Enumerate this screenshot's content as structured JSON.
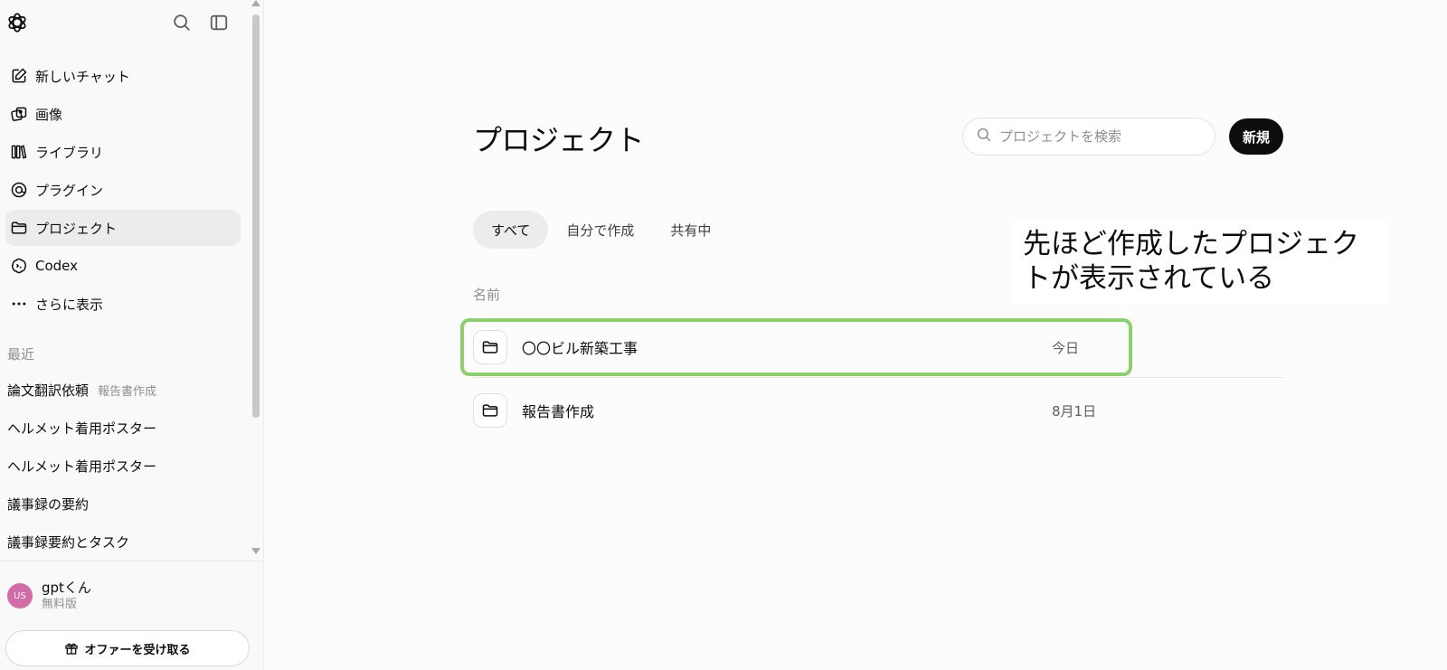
{
  "sidebar": {
    "nav": [
      {
        "label": "新しいチャット",
        "icon": "edit-icon"
      },
      {
        "label": "画像",
        "icon": "images-icon"
      },
      {
        "label": "ライブラリ",
        "icon": "library-icon"
      },
      {
        "label": "プラグイン",
        "icon": "plugin-icon"
      },
      {
        "label": "プロジェクト",
        "icon": "folder-icon",
        "active": true
      },
      {
        "label": "Codex",
        "icon": "codex-icon"
      },
      {
        "label": "さらに表示",
        "icon": "more-icon"
      }
    ],
    "recent_label": "最近",
    "recent": [
      {
        "label": "論文翻訳依頼",
        "sub": "報告書作成"
      },
      {
        "label": "ヘルメット着用ポスター"
      },
      {
        "label": "ヘルメット着用ポスター"
      },
      {
        "label": "議事録の要約"
      },
      {
        "label": "議事録要約とタスク"
      }
    ],
    "user": {
      "initials": "US",
      "name": "gptくん",
      "plan": "無料版"
    },
    "offer_label": "オファーを受け取る"
  },
  "main": {
    "title": "プロジェクト",
    "search": {
      "placeholder": "プロジェクトを検索",
      "value": ""
    },
    "new_label": "新規",
    "tabs": [
      {
        "label": "すべて",
        "active": true
      },
      {
        "label": "自分で作成"
      },
      {
        "label": "共有中"
      }
    ],
    "column_name": "名前",
    "projects": [
      {
        "name": "〇〇ビル新築工事",
        "date": "今日"
      },
      {
        "name": "報告書作成",
        "date": "8月1日"
      }
    ]
  },
  "annotation": {
    "text": "先ほど作成したプロジェクトが表示されている",
    "highlight_color": "#8bd16c"
  },
  "colors": {
    "accent": "#0d0d0d",
    "avatar": "#d36ba8"
  }
}
